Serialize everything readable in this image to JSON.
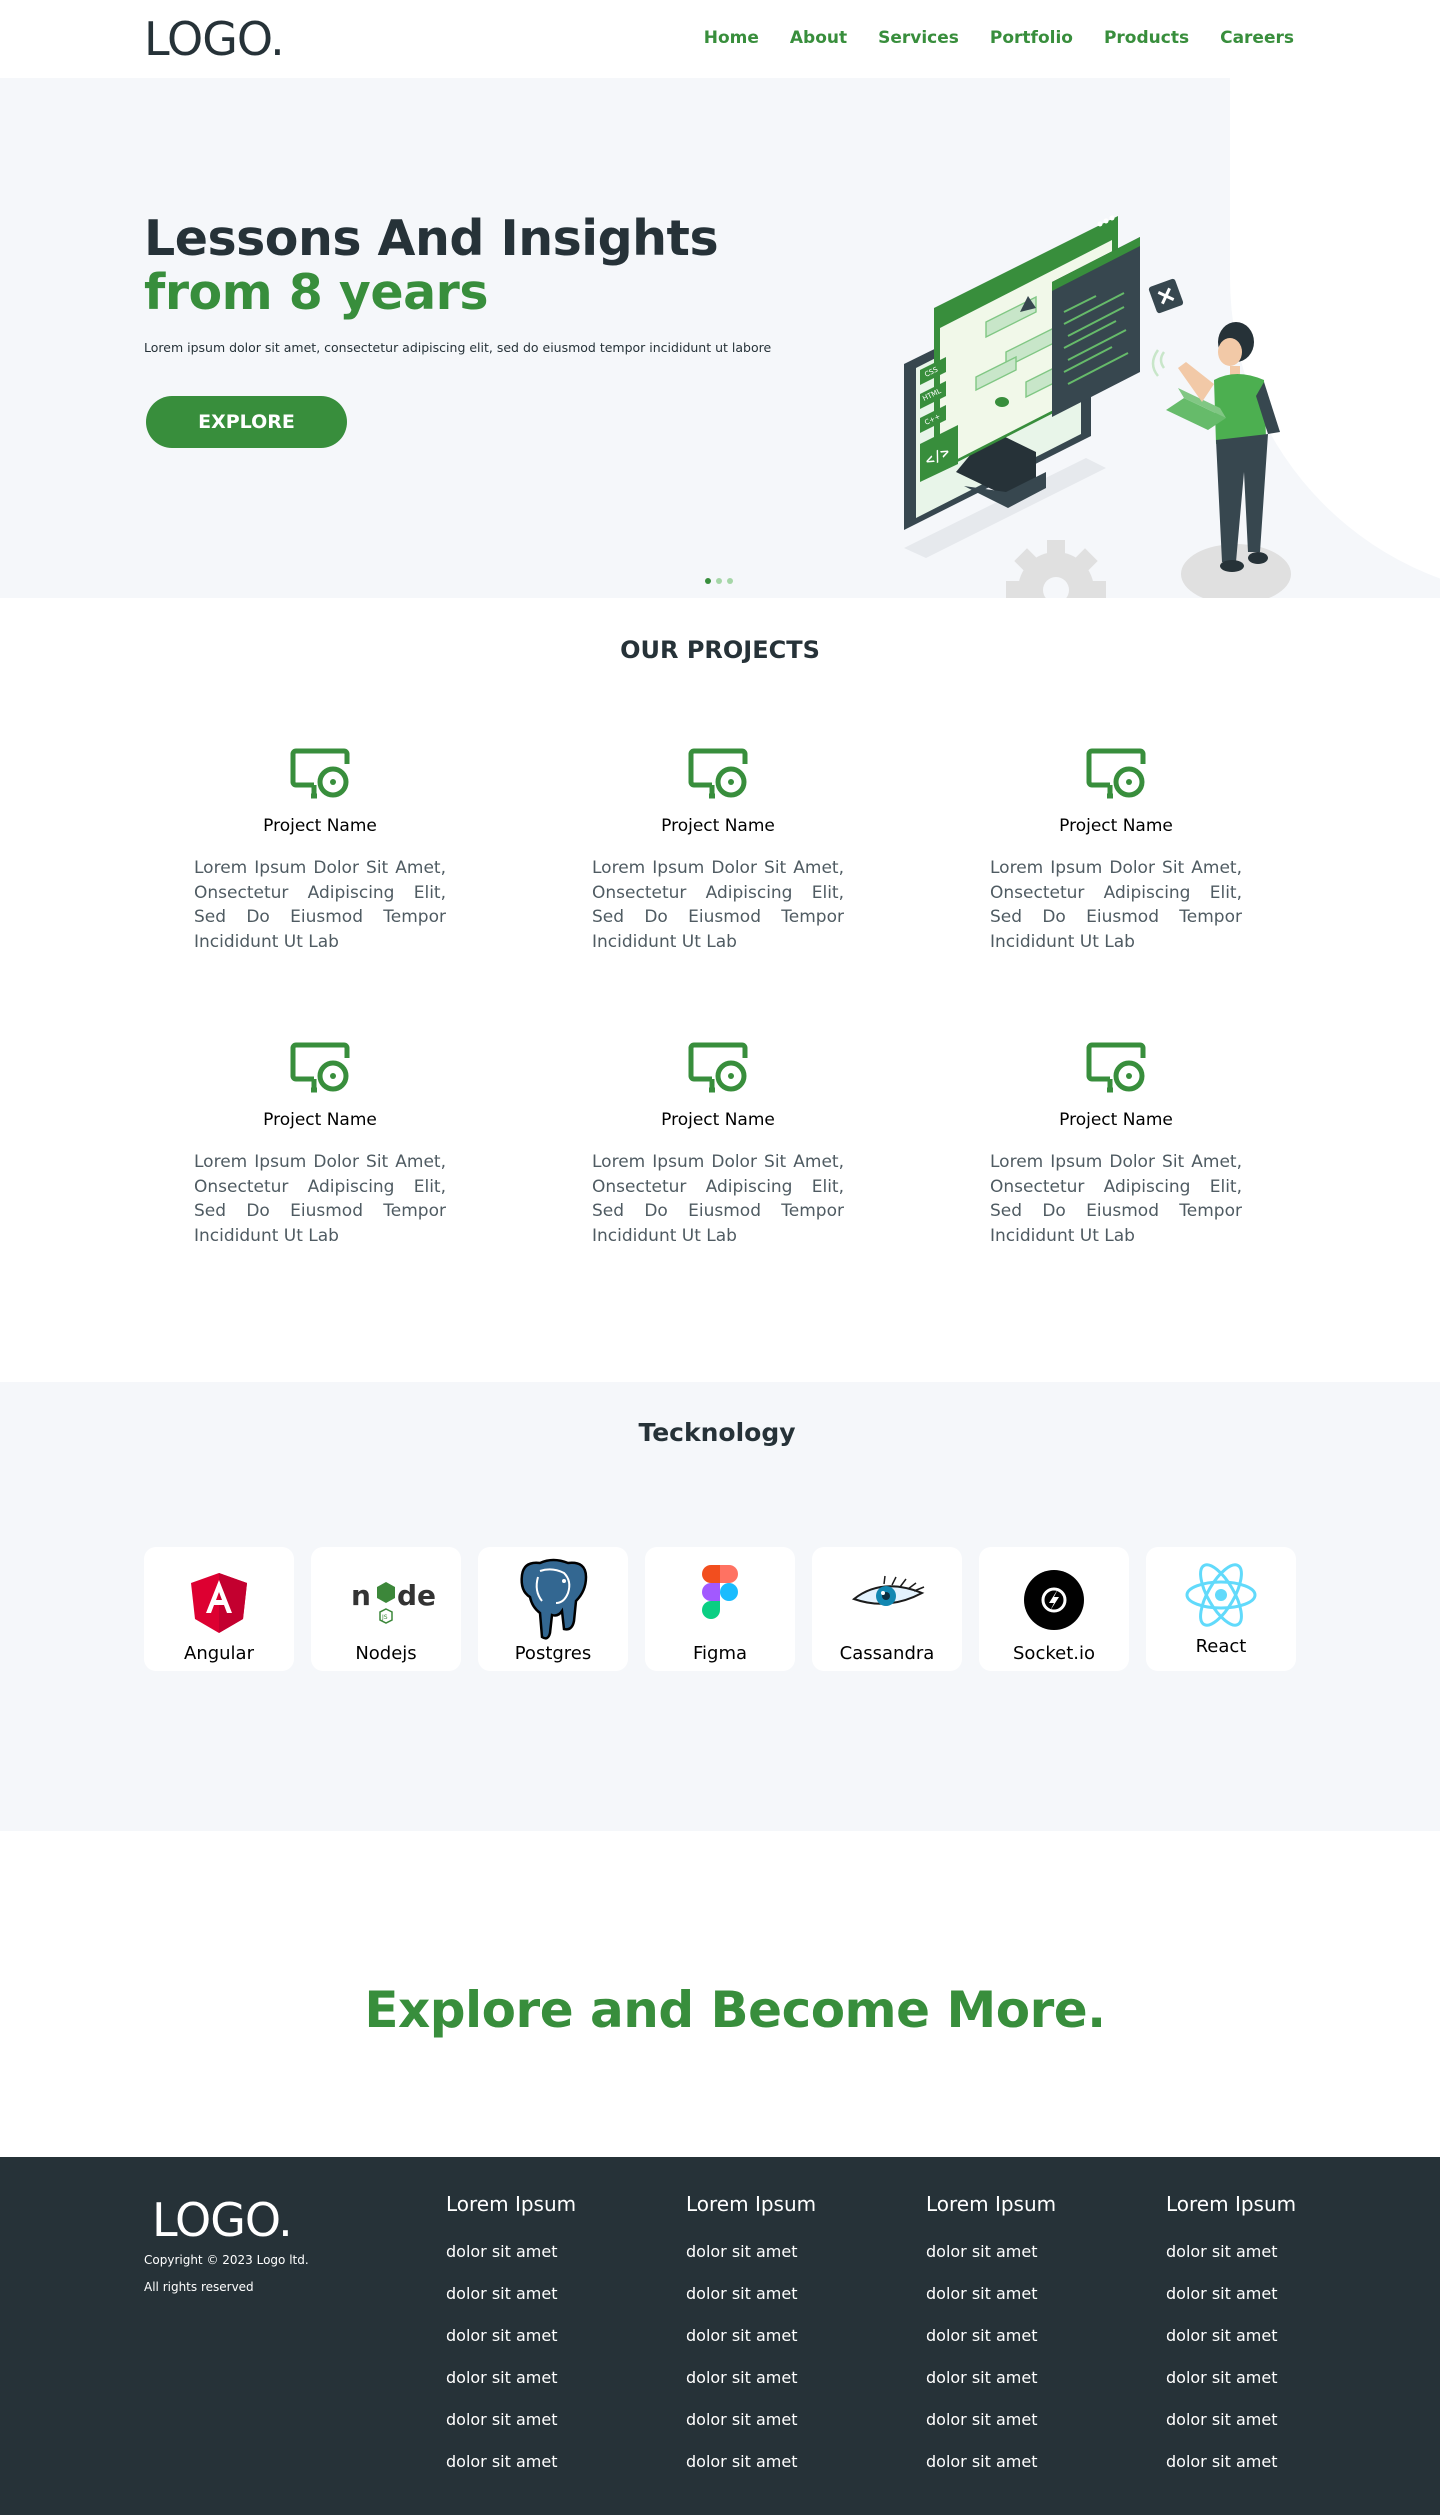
{
  "header": {
    "logo": "LOGO.",
    "nav": [
      "Home",
      "About",
      "Services",
      "Portfolio",
      "Products",
      "Careers"
    ]
  },
  "hero": {
    "title_line1": "Lessons And Insights",
    "title_line2": "from 8 years",
    "subtitle": "Lorem ipsum dolor sit amet, consectetur adipiscing elit, sed do eiusmod tempor incididunt ut labore",
    "button": "EXPLORE",
    "slides": 3,
    "active_slide": 1,
    "illustration_badges": [
      "CSS",
      "HTML",
      "C++"
    ]
  },
  "projects": {
    "title": "OUR PROJECTS",
    "items": [
      {
        "name": "Project Name",
        "desc": "Lorem Ipsum Dolor Sit Amet, Onsectetur Adipiscing Elit, Sed Do Eiusmod Tempor Incididunt Ut Lab",
        "icon": "monitor-disc-icon"
      },
      {
        "name": "Project Name",
        "desc": "Lorem Ipsum Dolor Sit Amet, Onsectetur Adipiscing Elit, Sed Do Eiusmod Tempor Incididunt Ut Lab",
        "icon": "monitor-disc-icon"
      },
      {
        "name": "Project Name",
        "desc": "Lorem Ipsum Dolor Sit Amet, Onsectetur Adipiscing Elit, Sed Do Eiusmod Tempor Incididunt Ut Lab",
        "icon": "monitor-disc-icon"
      },
      {
        "name": "Project Name",
        "desc": "Lorem Ipsum Dolor Sit Amet, Onsectetur Adipiscing Elit, Sed Do Eiusmod Tempor Incididunt Ut Lab",
        "icon": "monitor-disc-icon"
      },
      {
        "name": "Project Name",
        "desc": "Lorem Ipsum Dolor Sit Amet, Onsectetur Adipiscing Elit, Sed Do Eiusmod Tempor Incididunt Ut Lab",
        "icon": "monitor-disc-icon"
      },
      {
        "name": "Project Name",
        "desc": "Lorem Ipsum Dolor Sit Amet, Onsectetur Adipiscing Elit, Sed Do Eiusmod Tempor Incididunt Ut Lab",
        "icon": "monitor-disc-icon"
      }
    ]
  },
  "technology": {
    "title": "Tecknology",
    "items": [
      {
        "name": "Angular",
        "icon": "angular-icon"
      },
      {
        "name": "Nodejs",
        "icon": "nodejs-icon"
      },
      {
        "name": "Postgres",
        "icon": "postgres-icon"
      },
      {
        "name": "Figma",
        "icon": "figma-icon"
      },
      {
        "name": "Cassandra",
        "icon": "cassandra-icon"
      },
      {
        "name": "Socket.io",
        "icon": "socketio-icon"
      },
      {
        "name": "React",
        "icon": "react-icon"
      }
    ]
  },
  "cta": {
    "text": "Explore and Become More."
  },
  "footer": {
    "logo": "LOGO.",
    "copyright": "Copyright © 2023 Logo ltd.",
    "rights": "All rights reserved",
    "columns": [
      {
        "title": "Lorem Ipsum",
        "links": [
          "dolor sit amet",
          "dolor sit amet",
          "dolor sit amet",
          "dolor sit amet",
          "dolor sit amet",
          "dolor sit amet"
        ]
      },
      {
        "title": "Lorem Ipsum",
        "links": [
          "dolor sit amet",
          "dolor sit amet",
          "dolor sit amet",
          "dolor sit amet",
          "dolor sit amet",
          "dolor sit amet"
        ]
      },
      {
        "title": "Lorem Ipsum",
        "links": [
          "dolor sit amet",
          "dolor sit amet",
          "dolor sit amet",
          "dolor sit amet",
          "dolor sit amet",
          "dolor sit amet"
        ]
      },
      {
        "title": "Lorem Ipsum",
        "links": [
          "dolor sit amet",
          "dolor sit amet",
          "dolor sit amet",
          "dolor sit amet",
          "dolor sit amet",
          "dolor sit amet"
        ]
      }
    ]
  },
  "colors": {
    "brand_green": "#388e3c",
    "dark": "#263238",
    "light_bg": "#f5f7fa"
  }
}
